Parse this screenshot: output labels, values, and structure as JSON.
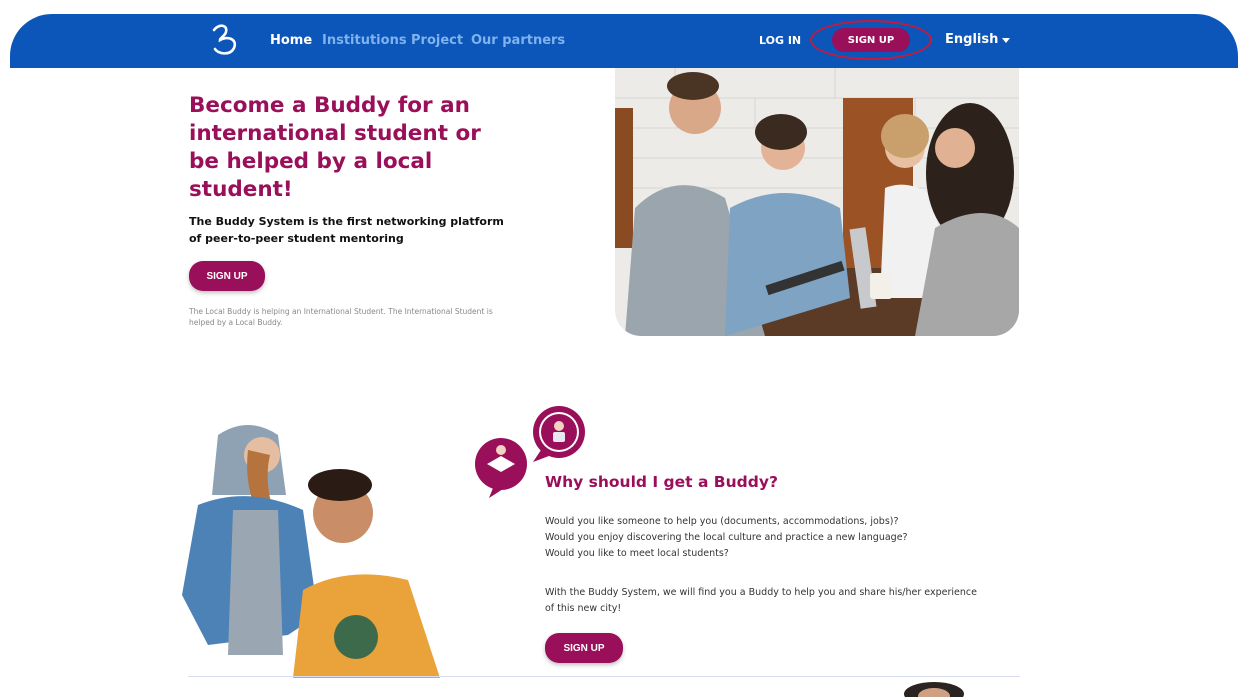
{
  "nav": {
    "links": [
      {
        "label": "Home",
        "active": true
      },
      {
        "label": "Institutions",
        "active": false
      },
      {
        "label": "Project",
        "active": false
      },
      {
        "label": "Our partners",
        "active": false
      }
    ],
    "login": "LOG IN",
    "signup": "SIGN UP",
    "language": "English"
  },
  "hero": {
    "title": "Become a Buddy for an international student or be helped by a local student!",
    "subtitle": "The Buddy System is the first networking platform of peer-to-peer student mentoring",
    "button": "SIGN UP",
    "note": "The Local Buddy is helping an International Student. The International Student is helped by a Local Buddy."
  },
  "why": {
    "title": "Why should I get a Buddy?",
    "questions": [
      "Would you like someone to help you (documents, accommodations, jobs)?",
      "Would you enjoy discovering the local culture and practice a new language?",
      "Would you like to meet local students?"
    ],
    "paragraph": "With the Buddy System, we will find you a Buddy to help you and share his/her experience of this new city!",
    "button": "SIGN UP"
  },
  "colors": {
    "nav_bg": "#0b56b8",
    "accent": "#9a0f59",
    "ring": "#c51a3c"
  }
}
